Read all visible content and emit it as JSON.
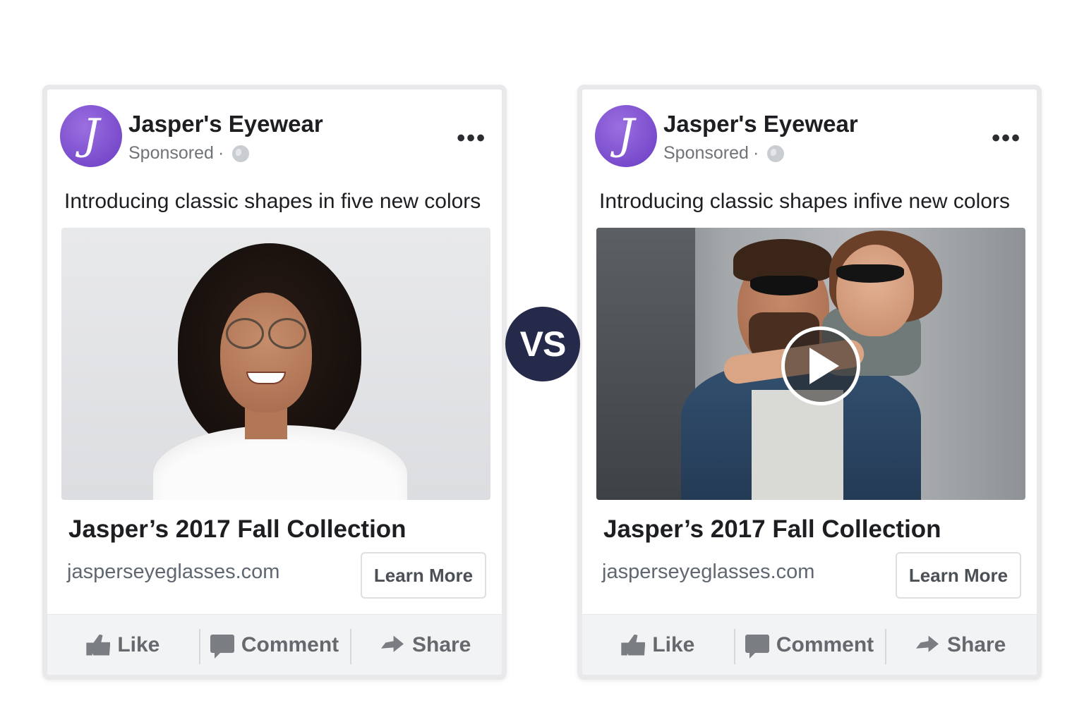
{
  "ads": [
    {
      "page_name": "Jasper's Eyewear",
      "logo_letter": "J",
      "sponsored": "Sponsored",
      "separator": "·",
      "more_menu": "•••",
      "caption": "Introducing classic shapes in five new colors",
      "media_type": "photo",
      "verdict": "check",
      "verdict_glyph": "✔",
      "verdict_color": "#7a4bc6",
      "headline": "Jasper’s 2017 Fall Collection",
      "domain": "jasperseyeglasses.com",
      "cta": "Learn More",
      "actions": {
        "like": "Like",
        "comment": "Comment",
        "share": "Share"
      }
    },
    {
      "page_name": "Jasper's Eyewear",
      "logo_letter": "J",
      "sponsored": "Sponsored",
      "separator": "·",
      "more_menu": "•••",
      "caption": "Introducing classic shapes infive new colors",
      "media_type": "video",
      "verdict": "cross",
      "verdict_glyph": "✕",
      "verdict_color": "#e5474f",
      "headline": "Jasper’s 2017 Fall Collection",
      "domain": "jasperseyeglasses.com",
      "cta": "Learn More",
      "actions": {
        "like": "Like",
        "comment": "Comment",
        "share": "Share"
      }
    }
  ],
  "vs_label": "VS",
  "colors": {
    "brand_purple": "#7a4bc6",
    "vs_navy": "#262a4a",
    "reject_red": "#e5474f"
  }
}
